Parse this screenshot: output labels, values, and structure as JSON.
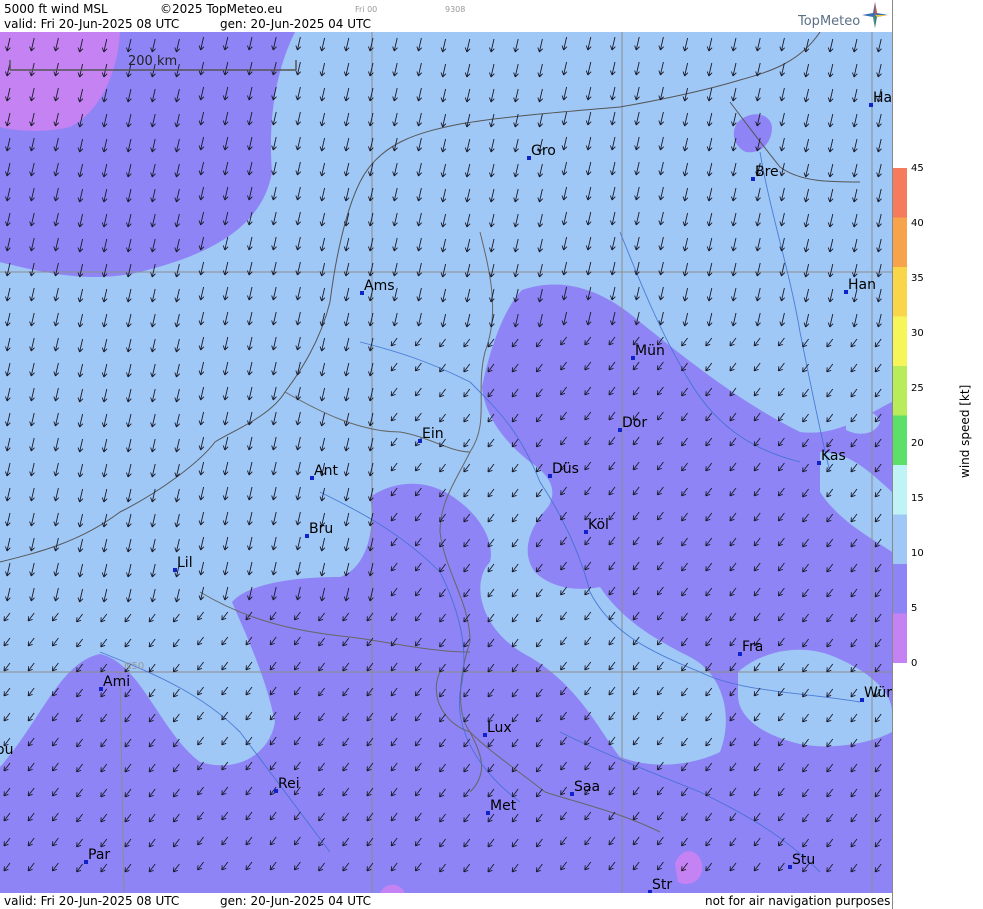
{
  "header": {
    "product": "5000 ft wind MSL",
    "copyright": "©2025 TopMeteo.eu",
    "run_tag": "Fri 00",
    "code_tag": "9308",
    "valid": "valid:  Fri  20-Jun-2025  08 UTC",
    "gen": "gen: 20-Jun-2025 04 UTC",
    "logo": "TopMeteo"
  },
  "footer": {
    "valid": "valid:  Fri  20-Jun-2025  08 UTC",
    "gen": "gen: 20-Jun-2025 04 UTC",
    "disclaimer": "not for air navigation purposes"
  },
  "map": {
    "scale_label": "200 km",
    "lat_label": "N50",
    "cities": [
      {
        "name": "Gro"
      },
      {
        "name": "Bre"
      },
      {
        "name": "Ha"
      },
      {
        "name": "Ams"
      },
      {
        "name": "Han"
      },
      {
        "name": "Mün"
      },
      {
        "name": "Dor"
      },
      {
        "name": "Ein"
      },
      {
        "name": "Kas"
      },
      {
        "name": "Düs"
      },
      {
        "name": "Ant"
      },
      {
        "name": "Köl"
      },
      {
        "name": "Bru"
      },
      {
        "name": "Lil"
      },
      {
        "name": "Fra"
      },
      {
        "name": "Ami"
      },
      {
        "name": "Wür"
      },
      {
        "name": "ou"
      },
      {
        "name": "Lux"
      },
      {
        "name": "Rei"
      },
      {
        "name": "Saa"
      },
      {
        "name": "Met"
      },
      {
        "name": "Par"
      },
      {
        "name": "Stu"
      },
      {
        "name": "Str"
      }
    ]
  },
  "legend": {
    "title": "wind speed [kt]",
    "ticks": [
      "45",
      "40",
      "35",
      "30",
      "25",
      "20",
      "15",
      "10",
      "5",
      "0"
    ],
    "colors": [
      "#f47c5c",
      "#f6a34c",
      "#f9d54a",
      "#f6f65a",
      "#b9ec5a",
      "#5ce06a",
      "#bff3f5",
      "#9fc8f6",
      "#8f84f5",
      "#c482f2"
    ]
  },
  "colors": {
    "band_5_10": "#8f84f5",
    "band_10_15": "#9fc8f6",
    "band_0_5": "#c482f2",
    "city_marker": "#1022c8"
  }
}
